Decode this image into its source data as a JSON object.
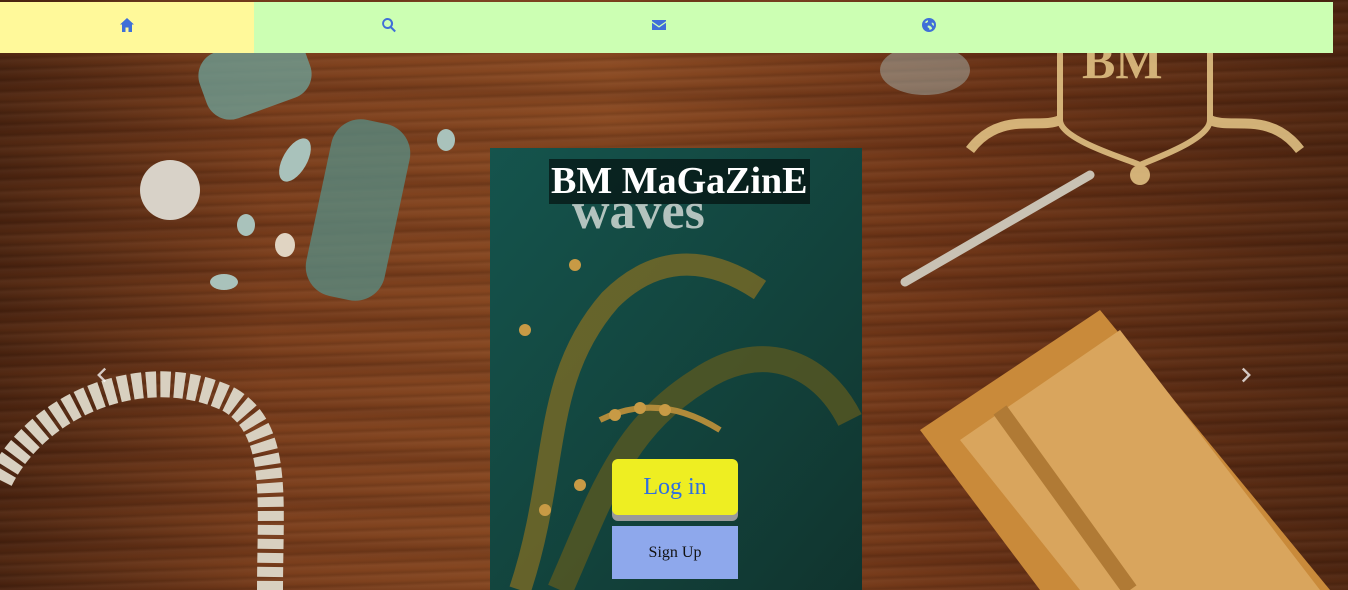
{
  "nav": {
    "items": [
      {
        "icon": "home-icon",
        "active": true
      },
      {
        "icon": "search-icon",
        "active": false
      },
      {
        "icon": "envelope-icon",
        "active": false
      },
      {
        "icon": "globe-icon",
        "active": false
      }
    ]
  },
  "hero": {
    "title": "BM MaGaZinE",
    "login_label": "Log in",
    "signup_label": "Sign Up"
  },
  "colors": {
    "nav_bg": "#ccffb3",
    "nav_active": "#fff99a",
    "icon": "#3f6fd8",
    "login_bg": "#eeee22",
    "login_text": "#2f6fe0",
    "signup_bg": "#8ea8ec"
  }
}
